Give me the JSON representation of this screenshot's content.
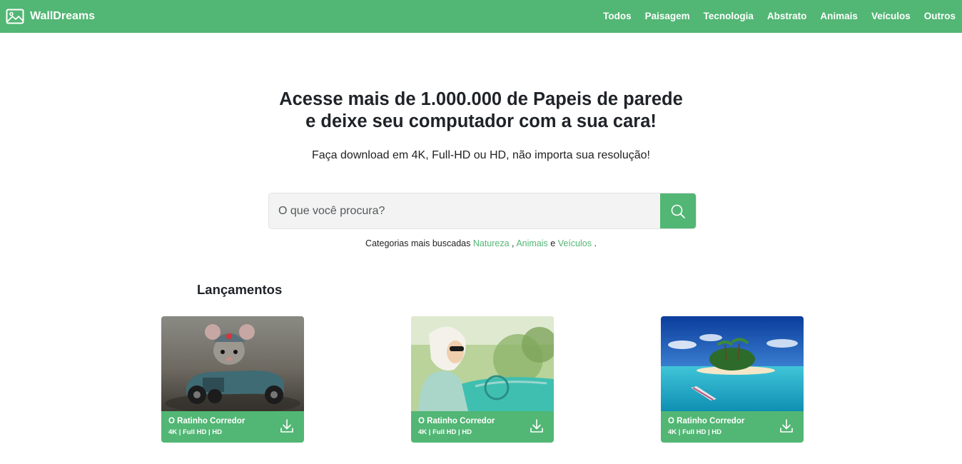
{
  "brand": {
    "name": "WallDreams",
    "logo_icon": "image-icon"
  },
  "nav": {
    "links": [
      "Todos",
      "Paisagem",
      "Tecnologia",
      "Abstrato",
      "Animais",
      "Veículos",
      "Outros"
    ]
  },
  "hero": {
    "title_line1": "Acesse mais de 1.000.000 de Papeis de parede",
    "title_line2": "e deixe seu computador com a sua cara!",
    "subtitle": "Faça download em 4K, Full-HD ou HD, não importa sua resolução!"
  },
  "search": {
    "placeholder": "O que você procura?",
    "value": "",
    "button_icon": "search-icon"
  },
  "popular": {
    "prefix": "Categorias mais buscadas",
    "categories": [
      "Natureza",
      "Animais",
      "Veículos"
    ],
    "sep_comma": ",",
    "sep_and": "e",
    "suffix": "."
  },
  "releases": {
    "title": "Lançamentos",
    "cards": [
      {
        "title": "O Ratinho Corredor",
        "resolutions": "4K | Full HD | HD",
        "image": "mouse-race-car-photo"
      },
      {
        "title": "O Ratinho Corredor",
        "resolutions": "4K | Full HD | HD",
        "image": "woman-in-vintage-car-photo"
      },
      {
        "title": "O Ratinho Corredor",
        "resolutions": "4K | Full HD | HD",
        "image": "tropical-island-photo"
      }
    ]
  },
  "colors": {
    "accent": "#52b674",
    "text": "#1f2328",
    "search_bg": "#f3f3f3"
  }
}
